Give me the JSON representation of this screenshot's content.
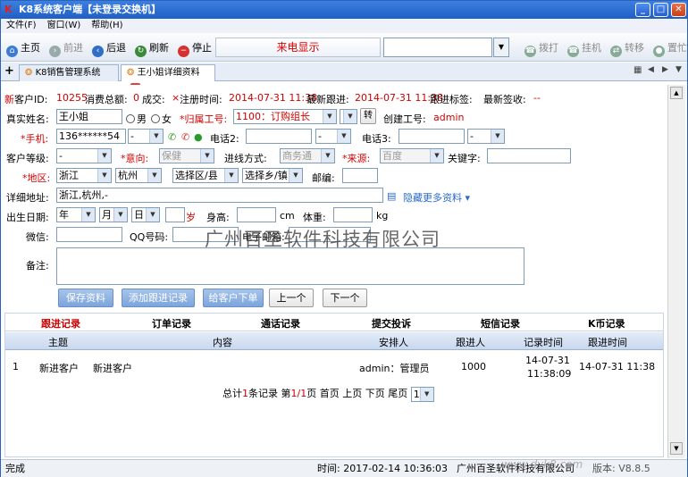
{
  "window": {
    "title": "K8系统客户端【未登录交换机】"
  },
  "menu": [
    "文件(F)",
    "窗口(W)",
    "帮助(H)"
  ],
  "toolbar": {
    "home": "主页",
    "forward": "前进",
    "back": "后退",
    "refresh": "刷新",
    "stop": "停止",
    "call_display": "来电显示",
    "dial": "拨打",
    "hangup": "挂机",
    "transfer": "转移",
    "hold": "置忙"
  },
  "tabs": [
    {
      "label": "K8销售管理系统"
    },
    {
      "label": "王小姐详细资料"
    }
  ],
  "summary": {
    "tag": "新",
    "id_label": "客户ID:",
    "id": "10255",
    "spend_label": "消费总额:",
    "spend": "0",
    "deal_label": "成交:",
    "deal_mark": "×",
    "reg_label": "注册时间:",
    "reg_time": "2014-07-31 11:38",
    "follow_label": "最新跟进:",
    "follow_time": "2014-07-31 11:38",
    "follow_tag_label": "跟进标签:",
    "sign_label": "最新签收:",
    "sign_value": "--"
  },
  "form": {
    "name_label": "真实姓名:",
    "name": "王小姐",
    "male": "男",
    "female": "女",
    "owner_label": "*归属工号:",
    "owner": "1100：订购组长",
    "transfer_btn": "转",
    "creator_label": "创建工号:",
    "creator": "admin",
    "mobile_label": "*手机:",
    "mobile": "136******54",
    "mobile_sel": "-",
    "phone2_label": "电话2:",
    "phone2_sel": "-",
    "phone3_label": "电话3:",
    "phone3_sel": "-",
    "level_label": "客户等级:",
    "level": "-",
    "intent_label": "*意向:",
    "intent": "保健",
    "channel_label": "进线方式:",
    "channel": "商务通",
    "source_label": "*来源:",
    "source": "百度",
    "keyword_label": "关键字:",
    "region_label": "*地区:",
    "province": "浙江",
    "city": "杭州",
    "district": "选择区/县",
    "town": "选择乡/镇",
    "zip_label": "邮编:",
    "address_label": "详细地址:",
    "address": "浙江,杭州,-",
    "more_label": "隐藏更多资料",
    "birth_label": "出生日期:",
    "year": "年",
    "month": "月",
    "day": "日",
    "age_unit": "岁",
    "height_label": "身高:",
    "height_unit": "cm",
    "weight_label": "体重:",
    "weight_unit": "kg",
    "wechat_label": "微信:",
    "qq_label": "QQ号码:",
    "email_label": "电子邮箱:",
    "remark_label": "备注:",
    "save": "保存资料",
    "add_follow": "添加跟进记录",
    "place_order": "给客户下单",
    "prev": "上一个",
    "next": "下一个"
  },
  "records": {
    "tabs": [
      "跟进记录",
      "订单记录",
      "通话记录",
      "提交投诉",
      "短信记录",
      "K币记录"
    ],
    "headers": [
      "主题",
      "内容",
      "安排人",
      "跟进人",
      "记录时间",
      "跟进时间"
    ],
    "rows": [
      {
        "no": "1",
        "topic": "新进客户",
        "content": "新进客户",
        "arranger": "admin：管理员",
        "follower": "1000",
        "rec_date": "14-07-31",
        "rec_time": "11:38:09",
        "follow_time": "14-07-31 11:38"
      }
    ],
    "pager": {
      "total_pre": "总计",
      "total": "1",
      "total_post": "条记录",
      "page_pre": "第",
      "page": "1/1",
      "page_post": "页",
      "first": "首页",
      "prev": "上页",
      "next": "下页",
      "last": "尾页",
      "select": "1"
    }
  },
  "status": {
    "left": "完成",
    "time": "时间: 2017-02-14 10:36:03",
    "company": "广州百圣软件科技有限公司",
    "version": "版本: V8.8.5",
    "url": "www.dyk8.com"
  },
  "watermark": "广州百圣软件科技有限公司"
}
